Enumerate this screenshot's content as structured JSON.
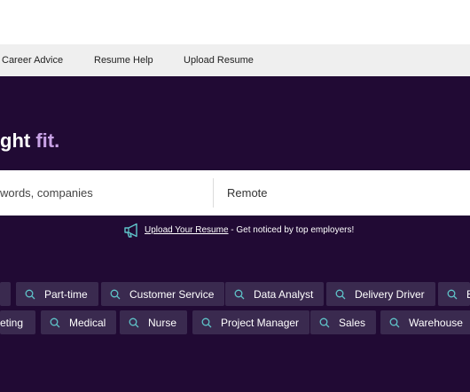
{
  "nav": {
    "items": [
      {
        "label": "Career Advice"
      },
      {
        "label": "Resume Help"
      },
      {
        "label": "Upload Resume"
      }
    ]
  },
  "hero": {
    "headline_main": "ght ",
    "headline_accent": "fit."
  },
  "search": {
    "keywords_placeholder": "words, companies",
    "location_value": "Remote"
  },
  "upload_banner": {
    "link_label": "Upload Your Resume",
    "tagline": " - Get noticed by top employers!",
    "icon": "megaphone-icon"
  },
  "chips": {
    "icon": "search-icon",
    "row1": [
      {
        "label": ""
      },
      {
        "label": "Part-time"
      },
      {
        "label": "Customer Service"
      },
      {
        "label": "Data Analyst"
      },
      {
        "label": "Delivery Driver"
      },
      {
        "label": "E"
      }
    ],
    "row2": [
      {
        "label": "eting"
      },
      {
        "label": "Medical"
      },
      {
        "label": "Nurse"
      },
      {
        "label": "Project Manager"
      },
      {
        "label": "Sales"
      },
      {
        "label": "Warehouse"
      }
    ]
  },
  "colors": {
    "background": "#210a34",
    "accent": "#c9a2e6",
    "chip": "#3a2a4f",
    "icon_teal": "#5fc4c9"
  }
}
